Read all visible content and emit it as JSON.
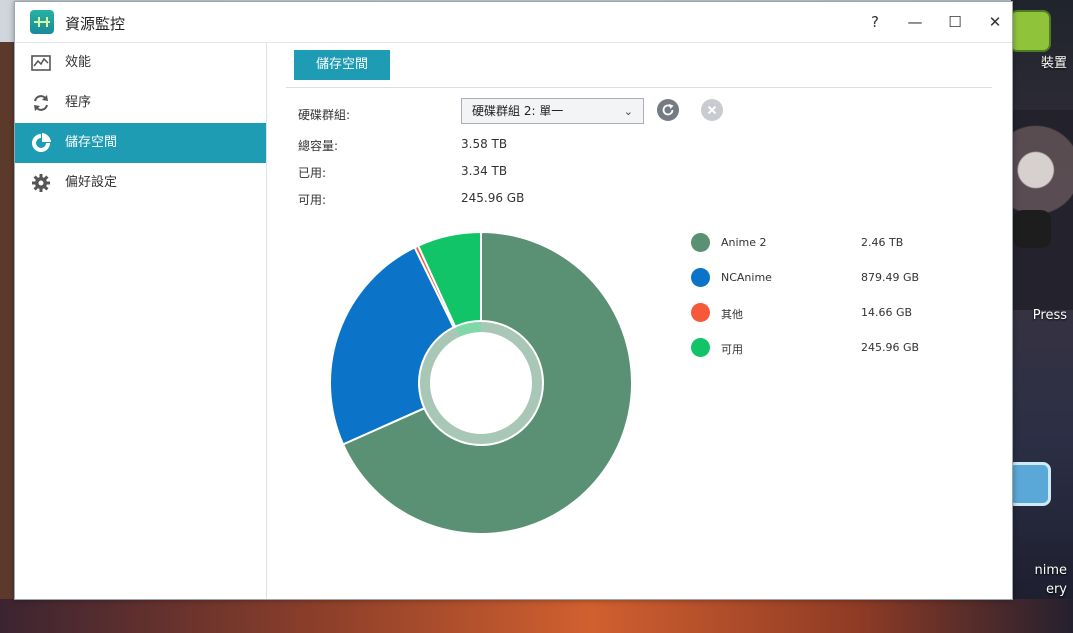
{
  "desktop": {
    "labels": [
      "裝置",
      "Press",
      "nime",
      "ery"
    ]
  },
  "window": {
    "title": "資源監控",
    "controls": {
      "help": "?",
      "minimize": "—",
      "maximize": "☐",
      "close": "✕"
    }
  },
  "sidebar": {
    "items": [
      {
        "label": "效能",
        "icon": "performance-icon"
      },
      {
        "label": "程序",
        "icon": "process-icon"
      },
      {
        "label": "儲存空間",
        "icon": "storage-icon",
        "active": true
      },
      {
        "label": "偏好設定",
        "icon": "gear-icon"
      }
    ]
  },
  "main": {
    "tab_label": "儲存空間",
    "fields": {
      "group_label": "硬碟群組:",
      "group_value": "硬碟群組 2: 單一",
      "total_label": "總容量:",
      "total_value": "3.58 TB",
      "used_label": "已用:",
      "used_value": "3.34 TB",
      "free_label": "可用:",
      "free_value": "245.96 GB"
    }
  },
  "chart_data": {
    "type": "pie",
    "style": "donut",
    "categories": [
      "Anime 2",
      "NCAnime",
      "其他",
      "可用"
    ],
    "value_labels": [
      "2.46 TB",
      "879.49 GB",
      "14.66 GB",
      "245.96 GB"
    ],
    "values": [
      2.46,
      0.879,
      0.0147,
      0.246
    ],
    "unit": "TB",
    "colors": [
      "#5a9073",
      "#0b74c8",
      "#f6583a",
      "#11c468"
    ],
    "inner_ring": {
      "used_fraction": 0.933,
      "used_color": "#a9c7b6",
      "free_color": "#7ed8a7"
    },
    "legend_position": "right"
  }
}
